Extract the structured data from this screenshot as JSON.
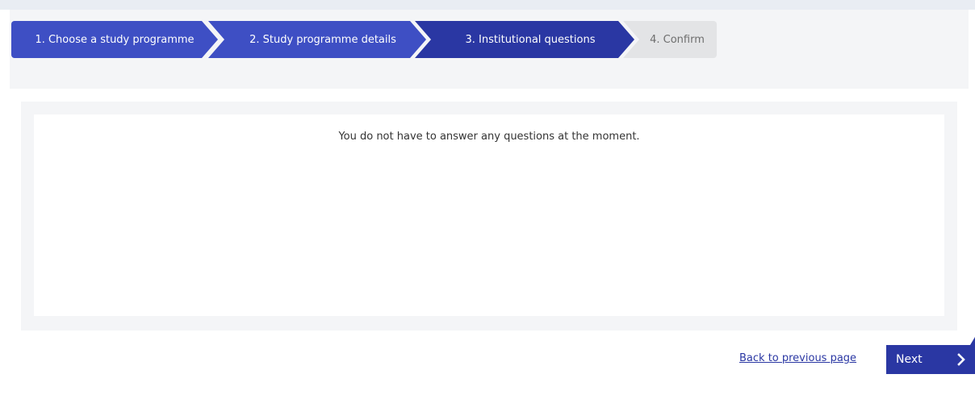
{
  "steps": [
    {
      "label": "1. Choose a study programme",
      "state": "completed"
    },
    {
      "label": "2. Study programme details",
      "state": "completed"
    },
    {
      "label": "3. Institutional questions",
      "state": "active"
    },
    {
      "label": "4. Confirm",
      "state": "pending"
    }
  ],
  "main": {
    "message": "You do not have to answer any questions at the moment."
  },
  "footer": {
    "back_label": "Back to previous page",
    "next_label": "Next"
  },
  "colors": {
    "step_completed": "#3e4fc4",
    "step_active": "#2a37a3",
    "step_pending": "#e3e4e6",
    "primary": "#2a37a3"
  }
}
